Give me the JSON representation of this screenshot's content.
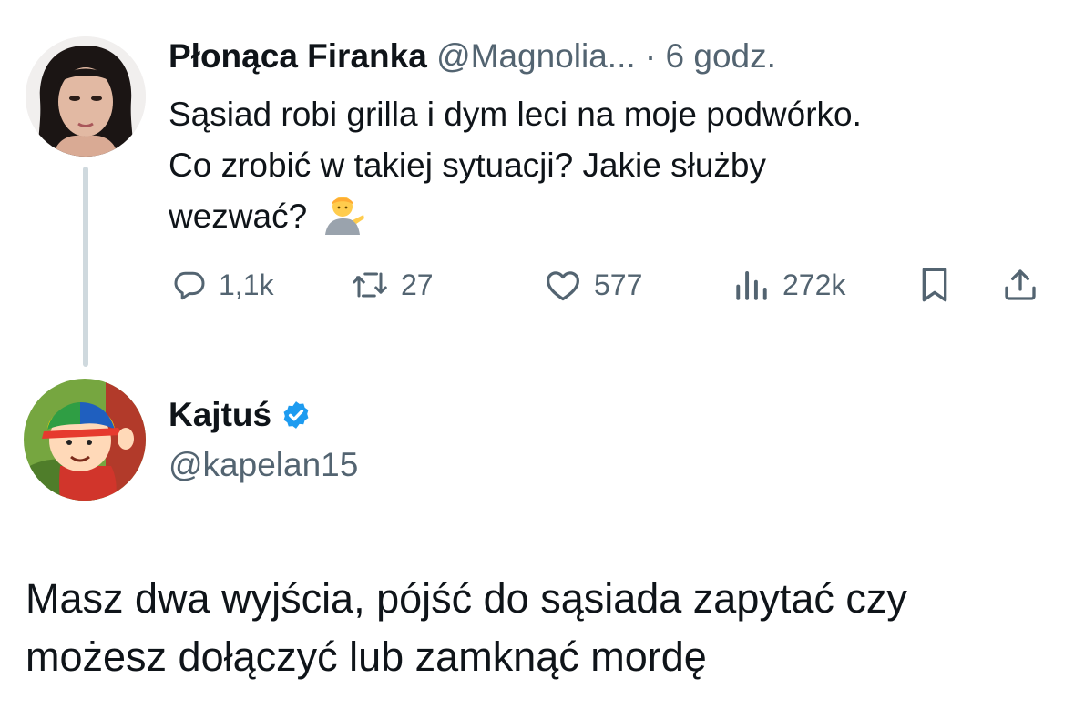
{
  "original_tweet": {
    "author_name": "Płonąca Firanka",
    "author_handle": "@Magnolia...",
    "separator": "·",
    "time": "6 godz.",
    "text_lines": [
      "Sąsiad robi grilla i dym leci na moje podwórko.",
      "Co zrobić w takiej sytuacji? Jakie służby",
      "wezwać?"
    ],
    "emoji": "💁",
    "stats": {
      "replies": "1,1k",
      "retweets": "27",
      "likes": "577",
      "views": "272k"
    },
    "icons": {
      "replies": "reply-icon",
      "retweets": "retweet-icon",
      "likes": "heart-icon",
      "views": "views-icon",
      "bookmark": "bookmark-icon",
      "share": "share-icon"
    }
  },
  "reply_tweet": {
    "author_name": "Kajtuś",
    "verified": true,
    "author_handle": "@kapelan15",
    "text_lines": [
      "Masz dwa wyjścia, pójść do sąsiada zapytać czy",
      "możesz dołączyć lub zamknąć mordę"
    ]
  },
  "colors": {
    "text": "#0f1419",
    "muted": "#536471",
    "thread_line": "#cfd9de",
    "verified_badge": "#1d9bf0"
  }
}
